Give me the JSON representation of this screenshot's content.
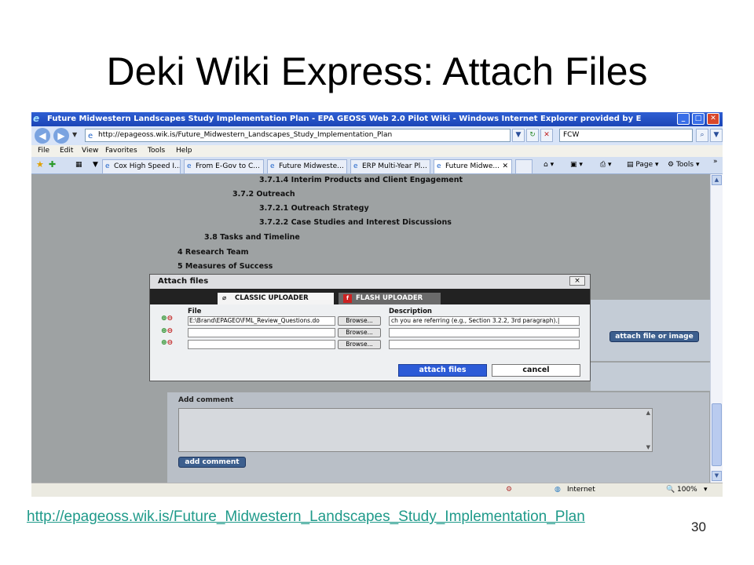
{
  "slide": {
    "title": "Deki Wiki Express: Attach Files",
    "footer_link": "http://epageoss.wik.is/Future_Midwestern_Landscapes_Study_Implementation_Plan",
    "slide_number": "30"
  },
  "browser": {
    "window_title": "Future Midwestern Landscapes Study Implementation Plan - EPA GEOSS Web 2.0 Pilot Wiki - Windows Internet Explorer provided by E",
    "address": "http://epageoss.wik.is/Future_Midwestern_Landscapes_Study_Implementation_Plan",
    "search_value": "FCW",
    "menu": [
      "File",
      "Edit",
      "View",
      "Favorites",
      "Tools",
      "Help"
    ],
    "tabs": [
      {
        "label": "Cox High Speed I..."
      },
      {
        "label": "From E-Gov to C..."
      },
      {
        "label": "Future Midweste..."
      },
      {
        "label": "ERP Multi-Year Pl..."
      },
      {
        "label": "Future Midwe...",
        "active": true
      }
    ],
    "toolbar": {
      "page_label": "Page",
      "tools_label": "Tools"
    },
    "status": {
      "zone": "Internet",
      "zoom": "100%"
    }
  },
  "page": {
    "toc": [
      "3.7.1.4 Interim Products and Client Engagement",
      "3.7.2 Outreach",
      "3.7.2.1 Outreach Strategy",
      "3.7.2.2 Case Studies and Interest Discussions",
      "3.8 Tasks and Timeline",
      "4 Research Team",
      "5 Measures of Success"
    ],
    "attach_button_label": "attach file or image",
    "add_comment_heading": "Add comment",
    "add_comment_button": "add comment"
  },
  "dialog": {
    "title": "Attach files",
    "close_label": "×",
    "tab_classic": "CLASSIC UPLOADER",
    "tab_flash": "FLASH UPLOADER",
    "col_file": "File",
    "col_description": "Description",
    "rows": [
      {
        "file": "E:\\Brand\\EPAGEO\\FML_Review_Questions.do",
        "description": "ch you are referring (e.g., Section 3.2.2, 3rd paragraph).|"
      },
      {
        "file": "",
        "description": ""
      },
      {
        "file": "",
        "description": ""
      }
    ],
    "browse_label": "Browse...",
    "attach_label": "attach files",
    "cancel_label": "cancel"
  }
}
